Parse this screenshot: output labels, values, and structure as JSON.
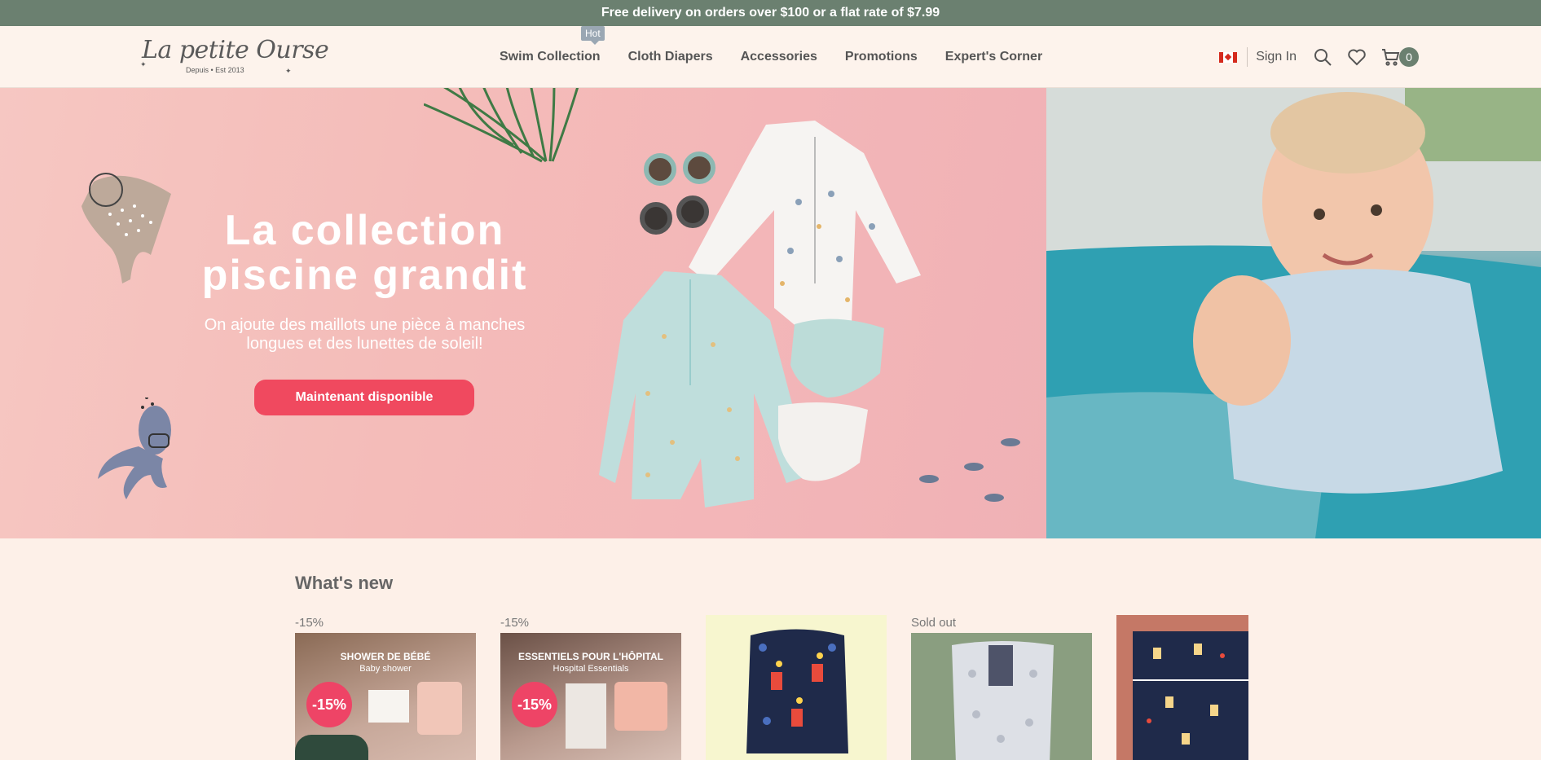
{
  "announcement": "Free delivery on orders over $100 or a flat rate of $7.99",
  "logo": {
    "script": "La petite Ourse",
    "tagline": "Depuis • Est 2013"
  },
  "nav": {
    "items": [
      {
        "label": "Swim Collection",
        "badge": "Hot"
      },
      {
        "label": "Cloth Diapers"
      },
      {
        "label": "Accessories"
      },
      {
        "label": "Promotions"
      },
      {
        "label": "Expert's Corner"
      }
    ]
  },
  "tools": {
    "country": "Canada",
    "signin": "Sign In",
    "cart_count": "0",
    "icons": [
      "search-icon",
      "heart-icon",
      "cart-icon"
    ]
  },
  "hero": {
    "title_line1": "La collection",
    "title_line2": "piscine grandit",
    "subtitle_line1": "On ajoute des maillots une pièce à manches",
    "subtitle_line2": "longues et des lunettes de soleil!",
    "cta": "Maintenant disponible"
  },
  "whats_new": {
    "title": "What's new",
    "products": [
      {
        "tag": "-15%",
        "banner_title": "SHOWER DE BÉBÉ",
        "banner_sub": "Baby shower",
        "badge": "-15%"
      },
      {
        "tag": "-15%",
        "banner_title": "ESSENTIELS POUR L'HÔPITAL",
        "banner_sub": "Hospital Essentials",
        "badge": "-15%"
      },
      {
        "tag": ""
      },
      {
        "tag": "Sold out"
      },
      {
        "tag": ""
      }
    ]
  },
  "colors": {
    "announce_bg": "#6b8070",
    "cta": "#f0495f",
    "page_bg": "#fdf0e8"
  }
}
